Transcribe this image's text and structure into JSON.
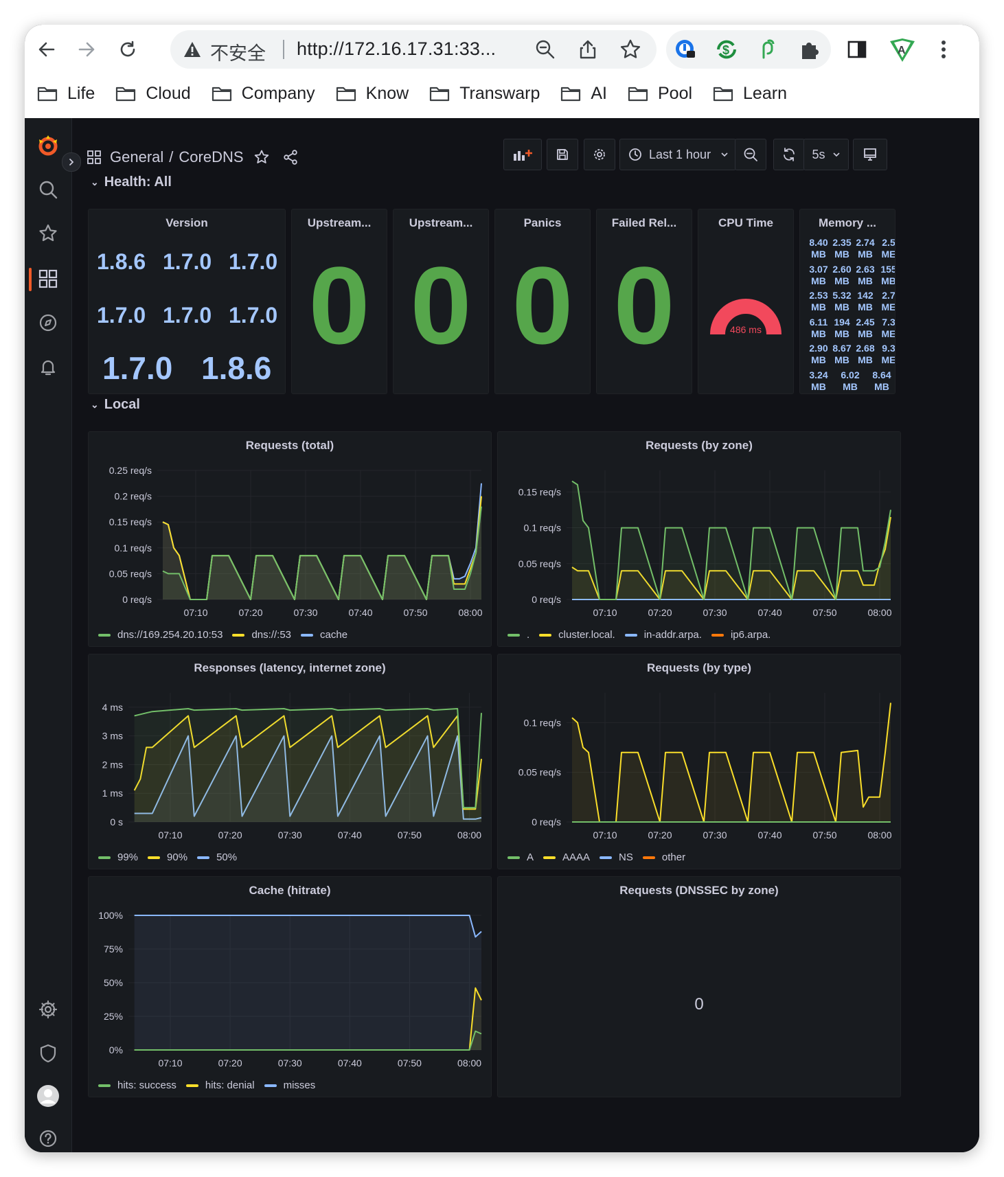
{
  "browser": {
    "insecure_label": "不安全",
    "url": "http://172.16.17.31:33...",
    "bookmarks": [
      "Life",
      "Cloud",
      "Company",
      "Know",
      "Transwarp",
      "AI",
      "Pool",
      "Learn"
    ]
  },
  "dashboard": {
    "folder": "General",
    "name": "CoreDNS",
    "time_range": "Last 1 hour",
    "refresh": "5s"
  },
  "rows": {
    "health": "Health: All",
    "local": "Local"
  },
  "stats": {
    "version": {
      "title": "Version",
      "values": [
        "1.8.6",
        "1.7.0",
        "1.7.0",
        "1.7.0",
        "1.7.0",
        "1.7.0",
        "1.7.0",
        "1.8.6"
      ]
    },
    "upstream1": {
      "title": "Upstream...",
      "value": "0"
    },
    "upstream2": {
      "title": "Upstream...",
      "value": "0"
    },
    "panics": {
      "title": "Panics",
      "value": "0"
    },
    "failed_reloads": {
      "title": "Failed Rel...",
      "value": "0"
    },
    "cpu_time": {
      "title": "CPU Time",
      "value": "486 ms",
      "gauge_fraction": 1.0,
      "color": "#f2495c",
      "threshold_colors": [
        "#56a64b",
        "#f2495c"
      ]
    },
    "memory": {
      "title": "Memory ...",
      "rows": [
        [
          "8.40",
          "2.35",
          "2.74",
          "2.5"
        ],
        [
          "3.07",
          "2.60",
          "2.63",
          "155"
        ],
        [
          "2.53",
          "5.32",
          "142",
          "2.7"
        ],
        [
          "6.11",
          "194",
          "2.45",
          "7.3"
        ],
        [
          "2.90",
          "8.67",
          "2.68",
          "9.3"
        ],
        [
          "3.24",
          "6.02",
          "8.64"
        ]
      ],
      "unit_rows": [
        [
          "MB",
          "MB",
          "MB",
          "ME"
        ],
        [
          "MB",
          "MB",
          "MB",
          "MB"
        ],
        [
          "MB",
          "MB",
          "MB",
          "ME"
        ],
        [
          "MB",
          "MB",
          "MB",
          "ME"
        ],
        [
          "MB",
          "MB",
          "MB",
          "ME"
        ],
        [
          "MB",
          "MB",
          "MB"
        ]
      ]
    },
    "dnssec": {
      "title": "Requests (DNSSEC by zone)",
      "value": "0"
    }
  },
  "chart_data": [
    {
      "id": "req_total",
      "type": "line",
      "title": "Requests (total)",
      "x": [
        "07:04",
        "07:05",
        "07:06",
        "07:07",
        "07:09",
        "07:12",
        "07:13",
        "07:16",
        "07:20",
        "07:21",
        "07:24",
        "07:28",
        "07:29",
        "07:32",
        "07:36",
        "07:37",
        "07:40",
        "07:44",
        "07:45",
        "07:48",
        "07:52",
        "07:53",
        "07:56",
        "07:57",
        "07:58",
        "07:59",
        "08:00",
        "08:01",
        "08:02"
      ],
      "x_ticks": [
        "07:10",
        "07:20",
        "07:30",
        "07:40",
        "07:50",
        "08:00"
      ],
      "y_ticks": [
        "0 req/s",
        "0.05 req/s",
        "0.1 req/s",
        "0.15 req/s",
        "0.2 req/s",
        "0.25 req/s"
      ],
      "ylim": [
        0,
        0.25
      ],
      "series": [
        {
          "name": "dns://169.254.20.10:53",
          "color": "#73bf69",
          "values": [
            0.055,
            0.05,
            0.05,
            0.05,
            0,
            0,
            0.085,
            0.085,
            0,
            0.085,
            0.085,
            0,
            0.085,
            0.085,
            0,
            0.085,
            0.085,
            0,
            0.085,
            0.085,
            0,
            0.085,
            0.085,
            0.02,
            0.02,
            0.02,
            0.05,
            0.09,
            0.18
          ]
        },
        {
          "name": "dns://:53",
          "color": "#fade2a",
          "values": [
            0.15,
            0.145,
            0.1,
            0.085,
            0,
            0,
            0.085,
            0.085,
            0,
            0.085,
            0.085,
            0,
            0.085,
            0.085,
            0,
            0.085,
            0.085,
            0,
            0.085,
            0.085,
            0,
            0.085,
            0.085,
            0.03,
            0.03,
            0.03,
            0.06,
            0.09,
            0.2
          ]
        },
        {
          "name": "cache",
          "color": "#8ab8ff",
          "values": [
            0.15,
            0.145,
            0.1,
            0.085,
            0,
            0,
            0.085,
            0.085,
            0,
            0.085,
            0.085,
            0,
            0.085,
            0.085,
            0,
            0.085,
            0.085,
            0,
            0.085,
            0.085,
            0,
            0.085,
            0.085,
            0.04,
            0.04,
            0.045,
            0.07,
            0.1,
            0.225
          ]
        }
      ]
    },
    {
      "id": "req_zone",
      "type": "line",
      "title": "Requests (by zone)",
      "x": [
        "07:04",
        "07:05",
        "07:06",
        "07:07",
        "07:09",
        "07:12",
        "07:13",
        "07:16",
        "07:20",
        "07:21",
        "07:24",
        "07:28",
        "07:29",
        "07:32",
        "07:36",
        "07:37",
        "07:40",
        "07:44",
        "07:45",
        "07:48",
        "07:52",
        "07:53",
        "07:56",
        "07:57",
        "07:58",
        "07:59",
        "08:00",
        "08:01",
        "08:02"
      ],
      "x_ticks": [
        "07:10",
        "07:20",
        "07:30",
        "07:40",
        "07:50",
        "08:00"
      ],
      "y_ticks": [
        "0 req/s",
        "0.05 req/s",
        "0.1 req/s",
        "0.15 req/s"
      ],
      "ylim": [
        0,
        0.18
      ],
      "series": [
        {
          "name": ".",
          "color": "#73bf69",
          "values": [
            0.165,
            0.16,
            0.11,
            0.1,
            0,
            0,
            0.1,
            0.1,
            0,
            0.1,
            0.1,
            0,
            0.1,
            0.1,
            0,
            0.1,
            0.1,
            0,
            0.1,
            0.1,
            0,
            0.1,
            0.1,
            0.04,
            0.04,
            0.04,
            0.045,
            0.08,
            0.125
          ]
        },
        {
          "name": "cluster.local.",
          "color": "#fade2a",
          "values": [
            0.045,
            0.04,
            0.04,
            0.04,
            0,
            0,
            0.04,
            0.04,
            0,
            0.04,
            0.04,
            0,
            0.04,
            0.04,
            0,
            0.04,
            0.04,
            0,
            0.04,
            0.04,
            0,
            0.04,
            0.04,
            0.02,
            0.02,
            0.02,
            0.05,
            0.07,
            0.115
          ]
        },
        {
          "name": "in-addr.arpa.",
          "color": "#8ab8ff",
          "values": [
            0,
            0,
            0,
            0,
            0,
            0,
            0,
            0,
            0,
            0,
            0,
            0,
            0,
            0,
            0,
            0,
            0,
            0,
            0,
            0,
            0,
            0,
            0,
            0,
            0,
            0,
            0,
            0,
            0
          ]
        },
        {
          "name": "ip6.arpa.",
          "color": "#ff780a",
          "values": [
            0,
            0,
            0,
            0,
            0,
            0,
            0,
            0,
            0,
            0,
            0,
            0,
            0,
            0,
            0,
            0,
            0,
            0,
            0,
            0,
            0,
            0,
            0,
            0,
            0,
            0,
            0,
            0,
            0
          ]
        }
      ]
    },
    {
      "id": "latency",
      "type": "area",
      "title": "Responses (latency, internet zone)",
      "x": [
        "07:04",
        "07:05",
        "07:06",
        "07:07",
        "07:13",
        "07:14",
        "07:21",
        "07:22",
        "07:29",
        "07:30",
        "07:37",
        "07:38",
        "07:45",
        "07:46",
        "07:53",
        "07:54",
        "07:58",
        "07:59",
        "08:01",
        "08:02"
      ],
      "x_ticks": [
        "07:10",
        "07:20",
        "07:30",
        "07:40",
        "07:50",
        "08:00"
      ],
      "y_ticks": [
        "0 s",
        "1 ms",
        "2 ms",
        "3 ms",
        "4 ms"
      ],
      "ylim": [
        0,
        4.5
      ],
      "series": [
        {
          "name": "99%",
          "color": "#73bf69",
          "values": [
            3.7,
            3.75,
            3.8,
            3.85,
            3.95,
            3.9,
            3.95,
            3.9,
            3.95,
            3.9,
            3.95,
            3.9,
            3.95,
            3.9,
            3.95,
            3.9,
            3.95,
            0.5,
            0.5,
            3.8
          ]
        },
        {
          "name": "90%",
          "color": "#fade2a",
          "values": [
            1.1,
            1.5,
            2.6,
            2.6,
            3.7,
            2.6,
            3.7,
            2.6,
            3.7,
            2.6,
            3.7,
            2.6,
            3.7,
            2.6,
            3.7,
            2.6,
            3.7,
            0.45,
            0.45,
            2.2
          ]
        },
        {
          "name": "50%",
          "color": "#8ab8ff",
          "values": [
            0.3,
            0.3,
            0.3,
            0.3,
            3.0,
            0.2,
            3.0,
            0.2,
            3.0,
            0.2,
            3.0,
            0.2,
            3.0,
            0.2,
            3.0,
            0.2,
            3.0,
            0.1,
            0.1,
            0.15
          ]
        }
      ]
    },
    {
      "id": "req_type",
      "type": "line",
      "title": "Requests (by type)",
      "x": [
        "07:04",
        "07:05",
        "07:06",
        "07:07",
        "07:09",
        "07:12",
        "07:13",
        "07:16",
        "07:20",
        "07:21",
        "07:24",
        "07:28",
        "07:29",
        "07:32",
        "07:36",
        "07:37",
        "07:40",
        "07:44",
        "07:45",
        "07:48",
        "07:52",
        "07:53",
        "07:56",
        "07:57",
        "07:58",
        "07:59",
        "08:00",
        "08:01",
        "08:02"
      ],
      "x_ticks": [
        "07:10",
        "07:20",
        "07:30",
        "07:40",
        "07:50",
        "08:00"
      ],
      "y_ticks": [
        "0 req/s",
        "0.05 req/s",
        "0.1 req/s"
      ],
      "ylim": [
        0,
        0.13
      ],
      "series": [
        {
          "name": "A",
          "color": "#73bf69",
          "values": [
            0,
            0,
            0,
            0,
            0,
            0,
            0,
            0,
            0,
            0,
            0,
            0,
            0,
            0,
            0,
            0,
            0,
            0,
            0,
            0,
            0,
            0,
            0,
            0,
            0,
            0,
            0,
            0,
            0
          ]
        },
        {
          "name": "AAAA",
          "color": "#fade2a",
          "values": [
            0.105,
            0.1,
            0.075,
            0.07,
            0,
            0,
            0.07,
            0.07,
            0,
            0.07,
            0.07,
            0,
            0.07,
            0.07,
            0,
            0.07,
            0.07,
            0,
            0.07,
            0.07,
            0,
            0.07,
            0.072,
            0.015,
            0.025,
            0.025,
            0.025,
            0.07,
            0.12
          ]
        },
        {
          "name": "NS",
          "color": "#8ab8ff",
          "values": [
            0,
            0,
            0,
            0,
            0,
            0,
            0,
            0,
            0,
            0,
            0,
            0,
            0,
            0,
            0,
            0,
            0,
            0,
            0,
            0,
            0,
            0,
            0,
            0,
            0,
            0,
            0,
            0,
            0
          ]
        },
        {
          "name": "other",
          "color": "#ff780a",
          "values": [
            0,
            0,
            0,
            0,
            0,
            0,
            0,
            0,
            0,
            0,
            0,
            0,
            0,
            0,
            0,
            0,
            0,
            0,
            0,
            0,
            0,
            0,
            0,
            0,
            0,
            0,
            0,
            0,
            0
          ]
        }
      ]
    },
    {
      "id": "cache_hit",
      "type": "line",
      "title": "Cache (hitrate)",
      "x": [
        "07:04",
        "07:30",
        "07:59",
        "08:00",
        "08:01",
        "08:02"
      ],
      "x_ticks": [
        "07:10",
        "07:20",
        "07:30",
        "07:40",
        "07:50",
        "08:00"
      ],
      "y_ticks": [
        "0%",
        "25%",
        "50%",
        "75%",
        "100%"
      ],
      "ylim": [
        0,
        100
      ],
      "series": [
        {
          "name": "hits: success",
          "color": "#73bf69",
          "values": [
            0,
            0,
            0,
            0,
            14,
            12
          ]
        },
        {
          "name": "hits: denial",
          "color": "#fade2a",
          "values": [
            0,
            0,
            0,
            0,
            46,
            37
          ]
        },
        {
          "name": "misses",
          "color": "#8ab8ff",
          "values": [
            100,
            100,
            100,
            100,
            84,
            88
          ]
        }
      ]
    }
  ]
}
